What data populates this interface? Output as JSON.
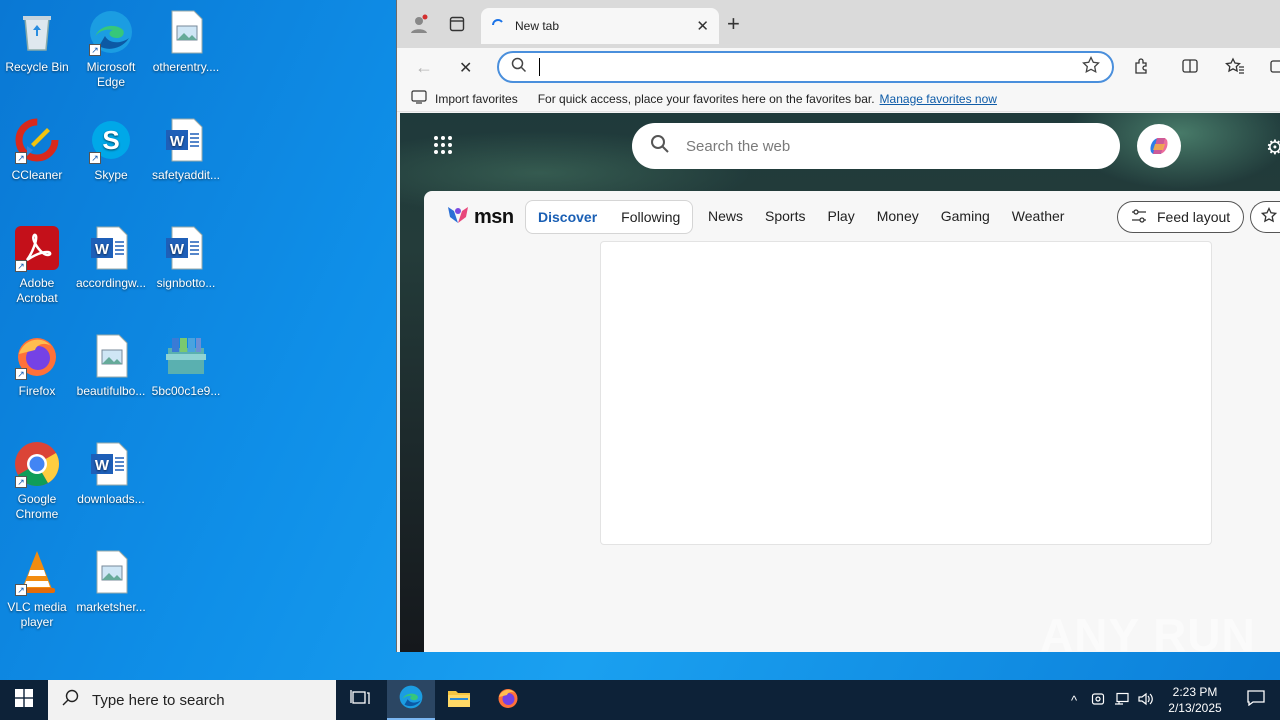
{
  "desktop": {
    "icons": [
      {
        "label": "Recycle Bin",
        "icon": "recycle-bin-icon"
      },
      {
        "label": "Microsoft Edge",
        "icon": "edge-icon"
      },
      {
        "label": "otherentry....",
        "icon": "image-file-icon"
      },
      {
        "label": "CCleaner",
        "icon": "ccleaner-icon"
      },
      {
        "label": "Skype",
        "icon": "skype-icon"
      },
      {
        "label": "safetyaddit...",
        "icon": "word-doc-icon"
      },
      {
        "label": "Adobe Acrobat",
        "icon": "acrobat-icon"
      },
      {
        "label": "accordingw...",
        "icon": "word-doc-icon"
      },
      {
        "label": "signbotto...",
        "icon": "word-doc-icon"
      },
      {
        "label": "Firefox",
        "icon": "firefox-icon"
      },
      {
        "label": "beautifulbo...",
        "icon": "image-file-icon"
      },
      {
        "label": "5bc00c1e9...",
        "icon": "archive-icon"
      },
      {
        "label": "Google Chrome",
        "icon": "chrome-icon"
      },
      {
        "label": "downloads...",
        "icon": "word-doc-icon"
      },
      {
        "label": "VLC media player",
        "icon": "vlc-icon"
      },
      {
        "label": "marketsher...",
        "icon": "image-file-icon"
      }
    ]
  },
  "browser": {
    "tab_title": "New tab",
    "address_placeholder": "",
    "favorites_bar": {
      "import_label": "Import favorites",
      "hint": "For quick access, place your favorites here on the favorites bar.",
      "manage_link": "Manage favorites now"
    },
    "new_tab_page": {
      "search_placeholder": "Search the web",
      "msn_logo_text": "msn",
      "tabs": [
        "Discover",
        "Following"
      ],
      "nav_links": [
        "News",
        "Sports",
        "Play",
        "Money",
        "Gaming",
        "Weather"
      ],
      "feed_layout_label": "Feed layout"
    }
  },
  "watermark": "ANY RUN",
  "taskbar": {
    "search_placeholder": "Type here to search",
    "time": "2:23 PM",
    "date": "2/13/2025"
  },
  "colors": {
    "desktop_blue": "#0f8fe8",
    "taskbar": "#0d2238",
    "edge_accent": "#4a8fdc",
    "msn_active": "#1a5fb4"
  }
}
